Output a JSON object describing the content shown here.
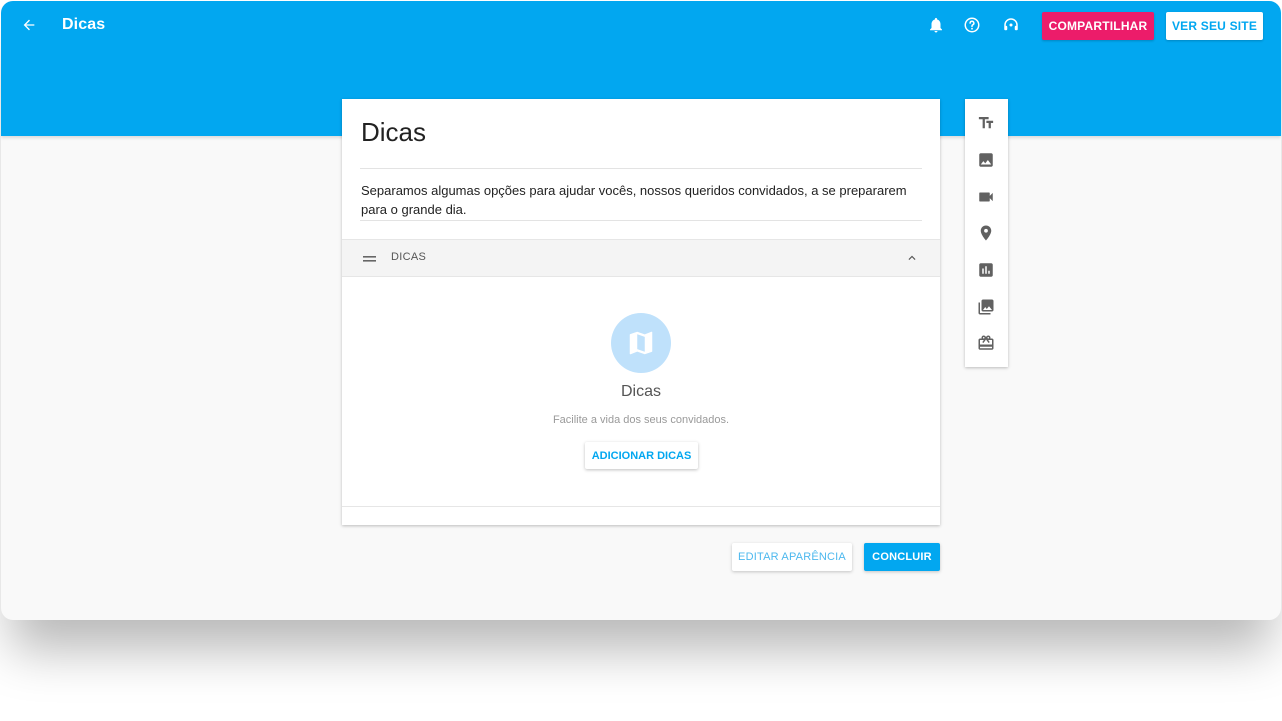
{
  "header": {
    "title": "Dicas",
    "back_icon": "arrow-left-icon",
    "icons": [
      "bell-icon",
      "help-icon",
      "support-icon"
    ],
    "share_label": "COMPARTILHAR",
    "view_site_label": "VER SEU SITE"
  },
  "card": {
    "title": "Dicas",
    "description": "Separamos algumas opções para ajudar vocês, nossos queridos convidados, a se prepararem para o grande dia.",
    "section": {
      "label": "DICAS",
      "empty_title": "Dicas",
      "empty_subtitle": "Facilite a vida dos seus convidados.",
      "add_label": "ADICIONAR DICAS"
    }
  },
  "toolbox": {
    "tools": [
      "text-icon",
      "image-icon",
      "video-icon",
      "location-icon",
      "chart-icon",
      "gallery-icon",
      "gift-icon"
    ]
  },
  "footer": {
    "appearance_label": "EDITAR APARÊNCIA",
    "done_label": "CONCLUIR"
  },
  "colors": {
    "primary": "#02a7f0",
    "accent": "#ec1c6a",
    "icon_gray": "#616161"
  }
}
